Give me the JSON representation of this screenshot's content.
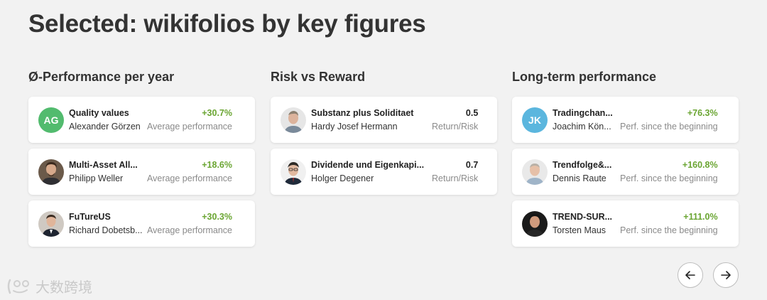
{
  "page": {
    "title": "Selected: wikifolios by key figures"
  },
  "columns": [
    {
      "title": "Ø-Performance per year",
      "cards": [
        {
          "name": "Quality values",
          "trader": "Alexander Görzen",
          "value": "+30.7%",
          "metric": "Average performance",
          "avatar": {
            "type": "initials",
            "text": "AG",
            "color": "#52bb6e"
          }
        },
        {
          "name": "Multi-Asset All...",
          "trader": "Philipp Weller",
          "value": "+18.6%",
          "metric": "Average performance",
          "avatar": {
            "type": "photo"
          }
        },
        {
          "name": "FuTureUS",
          "trader": "Richard Dobetsb...",
          "value": "+30.3%",
          "metric": "Average performance",
          "avatar": {
            "type": "photo"
          }
        }
      ]
    },
    {
      "title": "Risk vs Reward",
      "cards": [
        {
          "name": "Substanz plus Soliditaet",
          "trader": "Hardy Josef Hermann",
          "value": "0.5",
          "metric": "Return/Risk",
          "avatar": {
            "type": "photo"
          }
        },
        {
          "name": "Dividende und Eigenkapi...",
          "trader": "Holger Degener",
          "value": "0.7",
          "metric": "Return/Risk",
          "avatar": {
            "type": "photo"
          }
        }
      ]
    },
    {
      "title": "Long-term performance",
      "cards": [
        {
          "name": "Tradingchan...",
          "trader": "Joachim Kön...",
          "value": "+76.3%",
          "metric": "Perf. since the beginning",
          "avatar": {
            "type": "initials",
            "text": "JK",
            "color": "#5bb6de"
          }
        },
        {
          "name": "Trendfolge&...",
          "trader": "Dennis Raute",
          "value": "+160.8%",
          "metric": "Perf. since the beginning",
          "avatar": {
            "type": "photo"
          }
        },
        {
          "name": "TREND-SUR...",
          "trader": "Torsten Maus",
          "value": "+111.0%",
          "metric": "Perf. since the beginning",
          "avatar": {
            "type": "photo"
          }
        }
      ]
    }
  ],
  "navigation": {
    "prev_icon": "arrow-left-icon",
    "next_icon": "arrow-right-icon"
  },
  "watermark": {
    "text": "大数跨境"
  },
  "colors": {
    "positive": "#6aa532",
    "background": "#f2f2f2",
    "card": "#ffffff"
  }
}
